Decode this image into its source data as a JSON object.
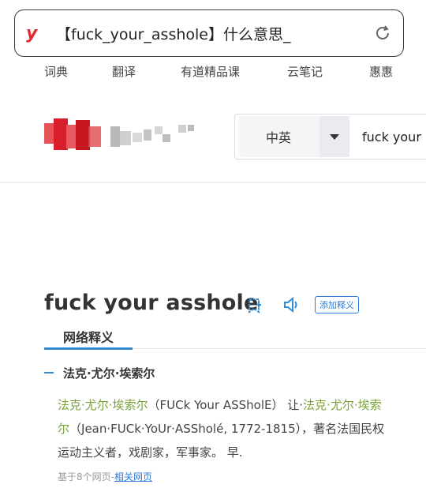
{
  "browser": {
    "site_logo": "y",
    "url_text": "【fuck_your_asshole】什么意思_",
    "reload_icon": "reload-icon"
  },
  "nav": {
    "items": [
      "词典",
      "翻译",
      "有道精品课",
      "云笔记",
      "惠惠"
    ]
  },
  "search": {
    "language": "中英",
    "query": "fuck your a"
  },
  "entry": {
    "headword": "fuck your asshole",
    "add_label": "添加释义",
    "tab_label": "网络释义",
    "sense_title": "法克·尤尔·埃索尔",
    "line1_green": "法克·尤尔·埃索尔",
    "line1_text": "（FUCk Your ASSholE） 让·",
    "line1_green2": "法克·尤尔·埃索",
    "line2_green": "尔",
    "line2_text": "（Jean·FUCk·YoUr·ASSholé, 1772-1815），著名法国民权",
    "line3_text": "运动主义者，戏剧家，军事家。 早.",
    "source_prefix": "基于8个网页-",
    "source_link": "相关网页"
  },
  "colors": {
    "accent": "#2e8bd6",
    "link": "#2e7bd6",
    "green": "#7aa23a",
    "logo_red": "#e8262d"
  }
}
